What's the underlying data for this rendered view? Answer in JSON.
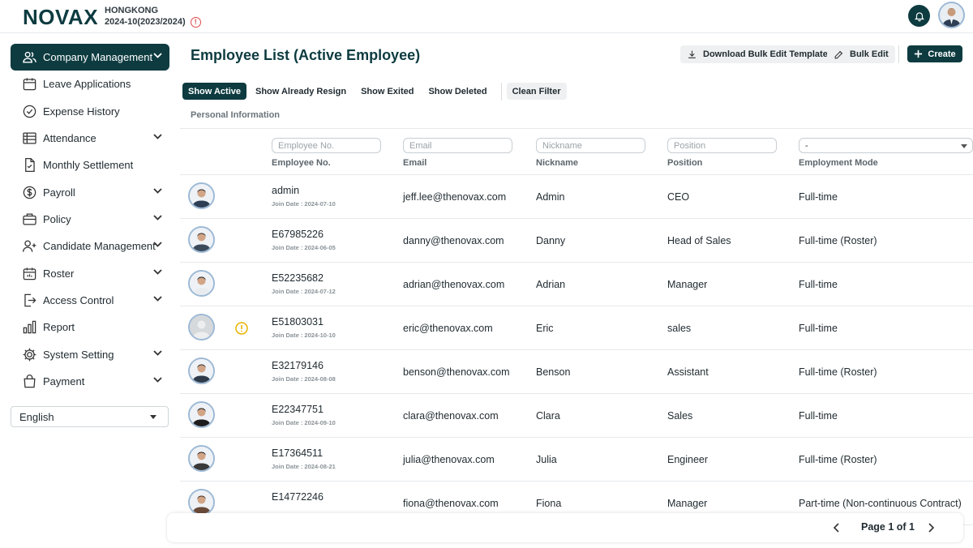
{
  "header": {
    "brand": "NOVAX",
    "company": "HONGKONG",
    "period": "2024-10(2023/2024)"
  },
  "sidebar": {
    "items": [
      {
        "label": "Company Management",
        "icon": "users-icon",
        "active": true,
        "expandable": true
      },
      {
        "label": "Leave Applications",
        "icon": "calendar-icon",
        "expandable": false
      },
      {
        "label": "Expense History",
        "icon": "check-circle-icon",
        "expandable": false
      },
      {
        "label": "Attendance",
        "icon": "table-icon",
        "expandable": true
      },
      {
        "label": "Monthly Settlement",
        "icon": "document-check-icon",
        "expandable": false
      },
      {
        "label": "Payroll",
        "icon": "dollar-icon",
        "expandable": true
      },
      {
        "label": "Policy",
        "icon": "briefcase-icon",
        "expandable": true
      },
      {
        "label": "Candidate Management",
        "icon": "user-plus-icon",
        "expandable": true
      },
      {
        "label": "Roster",
        "icon": "calendar-grid-icon",
        "expandable": true
      },
      {
        "label": "Access Control",
        "icon": "door-exit-icon",
        "expandable": true
      },
      {
        "label": "Report",
        "icon": "bar-chart-icon",
        "expandable": false
      },
      {
        "label": "System Setting",
        "icon": "gear-icon",
        "expandable": true
      },
      {
        "label": "Payment",
        "icon": "shopping-bag-icon",
        "expandable": true
      }
    ],
    "language": "English"
  },
  "main": {
    "title": "Employee List (Active Employee)",
    "actions": {
      "download_template": "Download Bulk Edit Template",
      "bulk_edit": "Bulk Edit",
      "create": "Create"
    },
    "filters": {
      "show_active": "Show Active",
      "show_resign": "Show Already Resign",
      "show_exited": "Show Exited",
      "show_deleted": "Show Deleted",
      "clean": "Clean Filter"
    },
    "section_label": "Personal Information",
    "columns": {
      "employee_no": {
        "label": "Employee No.",
        "placeholder": "Employee No."
      },
      "email": {
        "label": "Email",
        "placeholder": "Email"
      },
      "nickname": {
        "label": "Nickname",
        "placeholder": "Nickname"
      },
      "position": {
        "label": "Position",
        "placeholder": "Position"
      },
      "employment_mode": {
        "label": "Employment Mode",
        "selected": "-"
      }
    },
    "rows": [
      {
        "employee_no": "admin",
        "join_date": "Join Date : 2024-07-10",
        "email": "jeff.lee@thenovax.com",
        "nickname": "Admin",
        "position": "CEO",
        "mode": "Full-time",
        "warning": false,
        "photo": true
      },
      {
        "employee_no": "E67985226",
        "join_date": "Join Date : 2024-06-05",
        "email": "danny@thenovax.com",
        "nickname": "Danny",
        "position": "Head of Sales",
        "mode": "Full-time (Roster)",
        "warning": false,
        "photo": true
      },
      {
        "employee_no": "E52235682",
        "join_date": "Join Date : 2024-07-12",
        "email": "adrian@thenovax.com",
        "nickname": "Adrian",
        "position": "Manager",
        "mode": "Full-time",
        "warning": false,
        "photo": true
      },
      {
        "employee_no": "E51803031",
        "join_date": "Join Date : 2024-10-10",
        "email": "eric@thenovax.com",
        "nickname": "Eric",
        "position": "sales",
        "mode": "Full-time",
        "warning": true,
        "photo": false
      },
      {
        "employee_no": "E32179146",
        "join_date": "Join Date : 2024-08-08",
        "email": "benson@thenovax.com",
        "nickname": "Benson",
        "position": "Assistant",
        "mode": "Full-time (Roster)",
        "warning": false,
        "photo": true
      },
      {
        "employee_no": "E22347751",
        "join_date": "Join Date : 2024-09-10",
        "email": "clara@thenovax.com",
        "nickname": "Clara",
        "position": "Sales",
        "mode": "Full-time",
        "warning": false,
        "photo": true
      },
      {
        "employee_no": "E17364511",
        "join_date": "Join Date : 2024-08-21",
        "email": "julia@thenovax.com",
        "nickname": "Julia",
        "position": "Engineer",
        "mode": "Full-time (Roster)",
        "warning": false,
        "photo": true
      },
      {
        "employee_no": "E14772246",
        "join_date": "",
        "email": "fiona@thenovax.com",
        "nickname": "Fiona",
        "position": "Manager",
        "mode": "Part-time (Non-continuous Contract)",
        "warning": false,
        "photo": true
      }
    ]
  },
  "pagination": {
    "text": "Page 1 of 1"
  },
  "colors": {
    "brand": "#0d3b40",
    "warning": "#e8b400",
    "error": "#e04848"
  }
}
